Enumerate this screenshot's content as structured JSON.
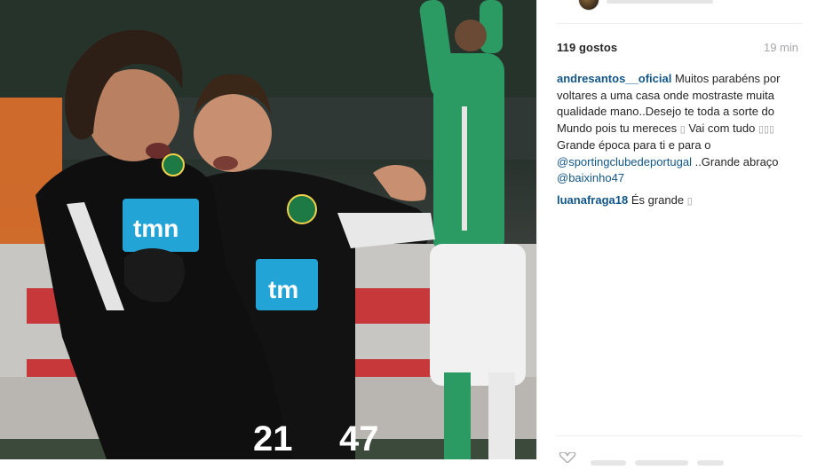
{
  "post": {
    "likes": "119 gostos",
    "time": "19 min"
  },
  "comments": [
    {
      "user": "andresantos__oficial",
      "text_parts": [
        {
          "t": " Muitos parabéns por voltares a uma casa onde mostraste muita qualidade mano..Desejo te toda a sorte do Mundo pois tu mereces "
        },
        {
          "sq": "▯"
        },
        {
          "t": " Vai com tudo "
        },
        {
          "sq": "▯▯▯"
        },
        {
          "t": " Grande época para ti e para o "
        },
        {
          "link": "@sportingclubedeportugal"
        },
        {
          "t": " ..Grande abraço "
        },
        {
          "link": "@baixinho47"
        }
      ]
    },
    {
      "user": "luanafraga18",
      "text_parts": [
        {
          "t": " És grande "
        },
        {
          "sq": "▯"
        }
      ]
    }
  ],
  "photo": {
    "jersey_sponsor": "tmn",
    "player_numbers": [
      "21",
      "47"
    ]
  },
  "icons": {
    "like": "heart-icon",
    "avatar": "user-avatar"
  },
  "colors": {
    "username": "#125688",
    "text": "#262626",
    "muted": "#a5a7aa",
    "sporting_kit": "#111111",
    "sponsor_cyan": "#23a4d6",
    "opponent_green": "#2c9a63"
  }
}
